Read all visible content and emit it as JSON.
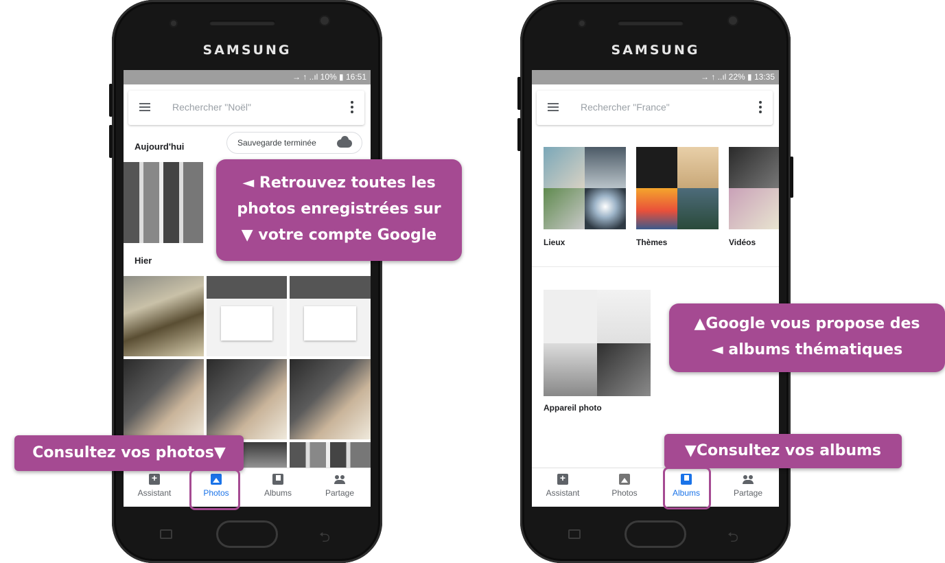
{
  "left_phone": {
    "brand": "SAMSUNG",
    "status": " → ↑ ..ıl 10% ▮ 16:51",
    "search_placeholder": "Rechercher \"Noël\"",
    "today_label": "Aujourd'hui",
    "backup_chip": "Sauvegarde terminée",
    "yesterday_label": "Hier",
    "nav": [
      {
        "label": "Assistant",
        "icon": "assistant-icon",
        "active": false
      },
      {
        "label": "Photos",
        "icon": "photos-icon",
        "active": true
      },
      {
        "label": "Albums",
        "icon": "albums-icon",
        "active": false
      },
      {
        "label": "Partage",
        "icon": "sharing-icon",
        "active": false
      }
    ]
  },
  "right_phone": {
    "brand": "SAMSUNG",
    "status": " → ↑ ..ıl 22% ▮ 13:35",
    "search_placeholder": "Rechercher \"France\"",
    "albums": [
      {
        "label": "Lieux"
      },
      {
        "label": "Thèmes"
      },
      {
        "label": "Vidéos"
      },
      {
        "label": "Appareil photo"
      }
    ],
    "nav": [
      {
        "label": "Assistant",
        "icon": "assistant-icon",
        "active": false
      },
      {
        "label": "Photos",
        "icon": "photos-icon",
        "active": false
      },
      {
        "label": "Albums",
        "icon": "albums-icon",
        "active": true
      },
      {
        "label": "Partage",
        "icon": "sharing-icon",
        "active": false
      }
    ]
  },
  "callouts": {
    "photos_saved": [
      "◄ Retrouvez toutes les",
      "photos enregistrées sur",
      "▼ votre compte Google"
    ],
    "consult_photos": "Consultez vos photos▼",
    "themed_albums": [
      "▲Google vous propose des",
      "◄ albums thématiques"
    ],
    "consult_albums": "▼Consultez vos albums"
  },
  "colors": {
    "callout": "#a54a92",
    "active_nav": "#1a73e8",
    "status_bar": "#9e9e9e"
  }
}
